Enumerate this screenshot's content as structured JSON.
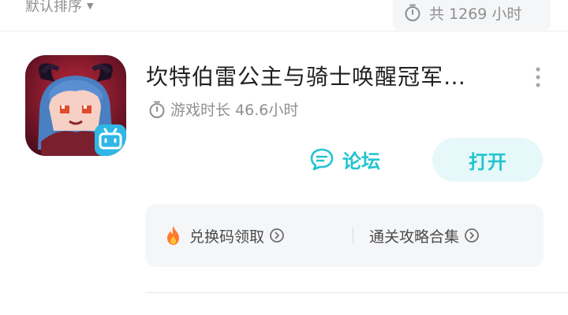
{
  "header": {
    "sort_label": "默认排序",
    "total_label": "共 1269 小时"
  },
  "app": {
    "title": "坎特伯雷公主与骑士唤醒冠军…",
    "playtime": "游戏时长 46.6小时",
    "forum_label": "论坛",
    "open_label": "打开",
    "icon_badge": "bilibili-tv-icon"
  },
  "links": [
    {
      "label": "兑换码领取",
      "icon": "fire-icon"
    },
    {
      "label": "通关攻略合集",
      "icon": ""
    }
  ],
  "colors": {
    "accent": "#20c4cf",
    "accent_bg": "#e6f8f9",
    "muted": "#8f8f8f",
    "card_bg": "#f5f6f8",
    "badge": "#2fb7e6"
  }
}
